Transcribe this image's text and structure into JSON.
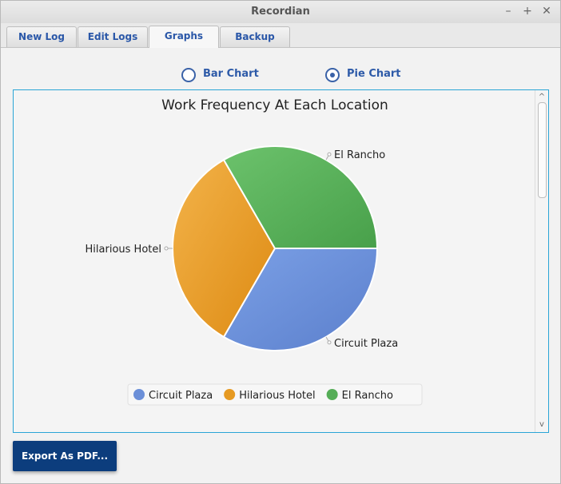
{
  "window": {
    "title": "Recordian",
    "minimize_glyph": "–",
    "maximize_glyph": "+",
    "close_glyph": "✕"
  },
  "tabs": [
    {
      "label": "New Log"
    },
    {
      "label": "Edit Logs"
    },
    {
      "label": "Graphs",
      "active": true
    },
    {
      "label": "Backup"
    }
  ],
  "chart_type_options": [
    {
      "label": "Bar Chart",
      "selected": false
    },
    {
      "label": "Pie Chart",
      "selected": true
    }
  ],
  "chart_data": {
    "type": "pie",
    "title": "Work Frequency At Each Location",
    "slices": [
      {
        "label": "Circuit Plaza",
        "value": 1,
        "color": "#6b8fd8"
      },
      {
        "label": "Hilarious Hotel",
        "value": 1,
        "color": "#e69a22"
      },
      {
        "label": "El Rancho",
        "value": 1,
        "color": "#55ad57"
      }
    ],
    "legend_position": "bottom"
  },
  "scrollbar": {
    "up_glyph": "^",
    "down_glyph": "v"
  },
  "export_button_label": "Export As PDF..."
}
